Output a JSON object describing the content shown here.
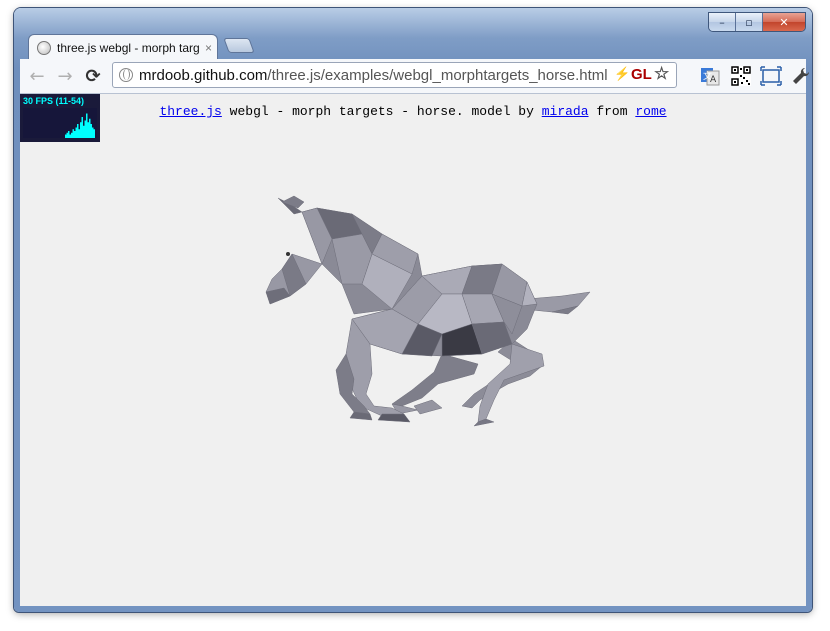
{
  "browser": {
    "tab_title": "three.js webgl - morph targ",
    "tab_close": "×",
    "url_host": "mrdoob.github.com",
    "url_path": "/three.js/examples/webgl_morphtargets_horse.html",
    "gl_badge": "GL",
    "window_controls": {
      "minimize": "–",
      "maximize": "▫",
      "close": "✕"
    },
    "nav": {
      "back": "←",
      "forward": "→",
      "reload": "⟳"
    }
  },
  "stats": {
    "fps_text": "30 FPS (11-54)",
    "graph_samples": [
      2,
      3,
      4,
      2,
      3,
      5,
      4,
      6,
      8,
      5,
      9,
      12,
      7,
      10,
      14,
      9,
      11,
      8,
      6,
      5
    ]
  },
  "info": {
    "link1": "three.js",
    "text1": " webgl - morph targets - horse. model by ",
    "link2": "mirada",
    "text2": " from ",
    "link3": "rome"
  },
  "colors": {
    "stats_fps": "#00ffff",
    "link": "#0000ee",
    "canvas_bg": "#f0f0f0",
    "horse_base": "#8a8a96"
  }
}
